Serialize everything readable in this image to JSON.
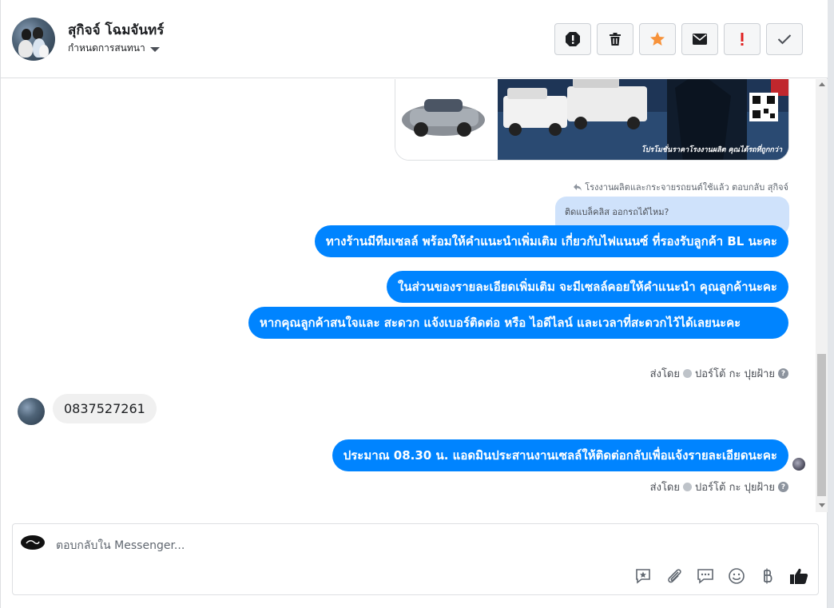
{
  "header": {
    "contact_name": "สุกิจจ์ โฉมจันทร์",
    "assign_label": "กำหนดการสนทนา",
    "actions": [
      {
        "name": "report-button",
        "icon": "alert-icon"
      },
      {
        "name": "delete-button",
        "icon": "trash-icon"
      },
      {
        "name": "star-button",
        "icon": "star-icon"
      },
      {
        "name": "mark-unread-button",
        "icon": "envelope-icon"
      },
      {
        "name": "follow-up-button",
        "icon": "exclamation-icon"
      },
      {
        "name": "done-button",
        "icon": "check-icon"
      }
    ]
  },
  "ad": {
    "caption": "โปรโมชั่นราคาโรงงานผลิต คุณได้รถที่ถูกกว่า"
  },
  "reply_meta": "โรงงานผลิตและกระจายรถยนต์ใช้แล้ว ตอบกลับ สุกิจจ์",
  "quote": "ติดแบล็คลิส ออกรถได้ไหม?",
  "messages": {
    "m1": "ทางร้านมีทีมเซลล์ พร้อมให้คำแนะนำเพิ่มเติม เกี่ยวกับไฟแนนซ์ ที่รองรับลูกค้า BL นะคะ",
    "m2": "ในส่วนของรายละเอียดเพิ่มเติม จะมีเซลล์คอยให้คำแนะนำ คุณลูกค้านะคะ",
    "m3": "หากคุณลูกค้าสนใจและ สะดวก แจ้งเบอร์ติดต่อ หรือ ไอดีไลน์ และเวลาที่สะดวกไว้ได้เลยนะคะ",
    "incoming": "0837527261",
    "m4": "ประมาณ 08.30 น. แอดมินประสานงานเซลล์ให้ติดต่อกลับเพื่อแจ้งรายละเอียดนะคะ"
  },
  "sent_by": {
    "prefix": "ส่งโดย",
    "name": "ปอร์โต้ กะ ปุยฝ้าย"
  },
  "composer": {
    "placeholder": "ตอบกลับใน Messenger..."
  },
  "colors": {
    "outgoing": "#0084ff",
    "incoming": "#f0f0f0",
    "star": "#f7923a",
    "follow_up": "#e02020"
  }
}
